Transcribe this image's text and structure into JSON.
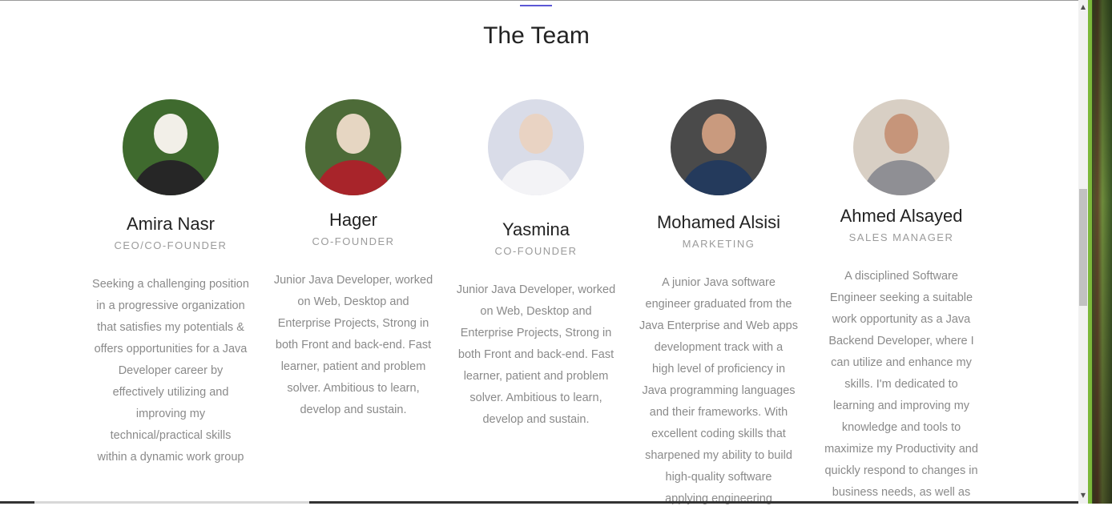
{
  "section": {
    "title": "The Team"
  },
  "team": [
    {
      "name": "Amira Nasr",
      "role": "CEO/CO-FOUNDER",
      "photo": "portrait-woman-hijab-white",
      "colors": {
        "bg": "#3f6a2e",
        "head": "#f2efe8",
        "body": "#262626"
      },
      "bio": [
        "Seeking a challenging position",
        "in a progressive organization",
        "that satisfies my potentials &",
        "offers opportunities for a Java",
        "Developer career by",
        "effectively utilizing and",
        "improving my",
        "technical/practical skills",
        "within a dynamic work group"
      ]
    },
    {
      "name": "Hager",
      "role": "CO-FOUNDER",
      "photo": "portrait-woman-hijab-beige",
      "colors": {
        "bg": "#4d6b38",
        "head": "#e6d6c2",
        "body": "#a8242a"
      },
      "bio": [
        "Junior Java Developer, worked",
        "on Web, Desktop and",
        "Enterprise Projects, Strong in",
        "both Front and back-end. Fast",
        "learner, patient and problem",
        "solver. Ambitious to learn,",
        "develop and sustain."
      ]
    },
    {
      "name": "Yasmina",
      "role": "CO-FOUNDER",
      "photo": "portrait-woman-hijab-floral",
      "colors": {
        "bg": "#d9dce8",
        "head": "#e9d3c3",
        "body": "#f3f3f6"
      },
      "bio": [
        "Junior Java Developer, worked",
        "on Web, Desktop and",
        "Enterprise Projects, Strong in",
        "both Front and back-end. Fast",
        "learner, patient and problem",
        "solver. Ambitious to learn,",
        "develop and sustain."
      ]
    },
    {
      "name": "Mohamed Alsisi",
      "role": "MARKETING",
      "photo": "portrait-man-glasses",
      "colors": {
        "bg": "#4a4a4a",
        "head": "#c99a7e",
        "body": "#243a5c"
      },
      "bio": [
        "A junior Java software",
        "engineer graduated from the",
        "Java Enterprise and Web apps",
        "development track with a",
        "high level of proficiency in",
        "Java programming languages",
        "and their frameworks. With",
        "excellent coding skills that",
        "sharpened my ability to build",
        "high-quality software",
        "applying engineering"
      ]
    },
    {
      "name": "Ahmed Alsayed",
      "role": "SALES MANAGER",
      "photo": "portrait-man-suit",
      "colors": {
        "bg": "#d8cfc4",
        "head": "#c6957a",
        "body": "#8f8f94"
      },
      "bio": [
        "A disciplined Software",
        "Engineer seeking a suitable",
        "work opportunity as a Java",
        "Backend Developer, where I",
        "can utilize and enhance my",
        "skills. I'm dedicated to",
        "learning and improving my",
        "knowledge and tools to",
        "maximize my Productivity and",
        "quickly respond to changes in",
        "business needs, as well as"
      ]
    }
  ],
  "scrollbar": {
    "up_icon": "triangle-up-icon",
    "down_icon": "triangle-down-icon",
    "scroll_fraction": 0.4
  }
}
